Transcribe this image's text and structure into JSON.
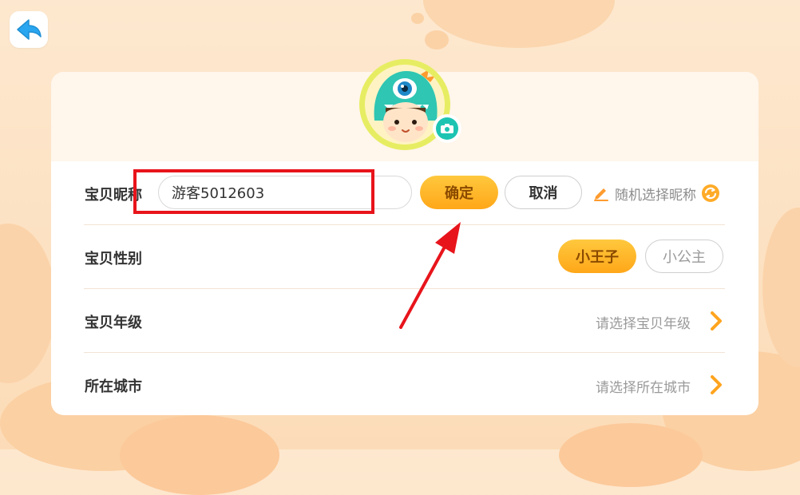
{
  "colors": {
    "accent_orange": "#ffb22c",
    "highlight_red": "#e8141b",
    "teal": "#1ec4b2",
    "back_blue": "#2aa6f0"
  },
  "back": {
    "icon": "back-arrow-icon"
  },
  "avatar": {
    "icon": "camera-icon"
  },
  "nickname": {
    "label": "宝贝昵称",
    "value": "游客5012603",
    "confirm_label": "确定",
    "cancel_label": "取消",
    "random_label": "随机选择昵称",
    "random_icons": [
      "pencil-icon",
      "refresh-icon"
    ]
  },
  "gender": {
    "label": "宝贝性别",
    "options": [
      "小王子",
      "小公主"
    ],
    "selected": "小王子"
  },
  "grade": {
    "label": "宝贝年级",
    "placeholder": "请选择宝贝年级"
  },
  "city": {
    "label": "所在城市",
    "placeholder": "请选择所在城市"
  }
}
